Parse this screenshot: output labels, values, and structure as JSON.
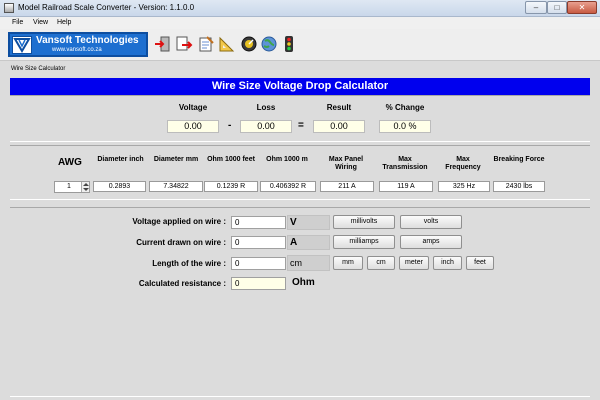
{
  "window": {
    "title": "Model Railroad Scale Converter - Version: 1.1.0.0"
  },
  "menu": [
    "File",
    "View",
    "Help"
  ],
  "logo": {
    "name": "Vansoft Technologies",
    "url": "www.vansoft.co.za"
  },
  "toolbar_icons": [
    "exit-icon",
    "export-icon",
    "notepad-icon",
    "set-square-icon",
    "gauge-icon",
    "globe-icon",
    "traffic-light-icon"
  ],
  "section_label": "Wire Size Calculator",
  "banner": "Wire Size Voltage Drop Calculator",
  "drop": {
    "labels": {
      "voltage": "Voltage",
      "loss": "Loss",
      "result": "Result",
      "change": "% Change"
    },
    "values": {
      "voltage": "0.00",
      "loss": "0.00",
      "result": "0.00",
      "change": "0.0 %"
    },
    "minus": "-",
    "equals": "="
  },
  "awg": {
    "label": "AWG",
    "value": "1",
    "columns": [
      {
        "header": "Diameter inch",
        "value": "0.2893"
      },
      {
        "header": "Diameter mm",
        "value": "7.34822"
      },
      {
        "header": "Ohm 1000 feet",
        "value": "0.1239 R"
      },
      {
        "header": "Ohm 1000 m",
        "value": "0.406392 R"
      },
      {
        "header": "Max Panel Wiring",
        "value": "211 A"
      },
      {
        "header": "Max Transmission",
        "value": "119 A"
      },
      {
        "header": "Max Frequency",
        "value": "325 Hz"
      },
      {
        "header": "Breaking Force",
        "value": "2430 lbs"
      }
    ]
  },
  "form": {
    "voltage": {
      "label": "Voltage applied on wire :",
      "value": "0",
      "unit": "V",
      "buttons": [
        "millivolts",
        "volts"
      ]
    },
    "current": {
      "label": "Current drawn on wire :",
      "value": "0",
      "unit": "A",
      "buttons": [
        "milliamps",
        "amps"
      ]
    },
    "length": {
      "label": "Length of the wire :",
      "value": "0",
      "unit": "cm",
      "buttons": [
        "mm",
        "cm",
        "meter",
        "inch",
        "feet"
      ]
    },
    "resistance": {
      "label": "Calculated resistance :",
      "value": "0",
      "unit": "Ohm"
    }
  },
  "colors": {
    "banner": "#0000ee",
    "value_bg": "#ffffe8",
    "logo_bg": "#1d6fd0"
  }
}
